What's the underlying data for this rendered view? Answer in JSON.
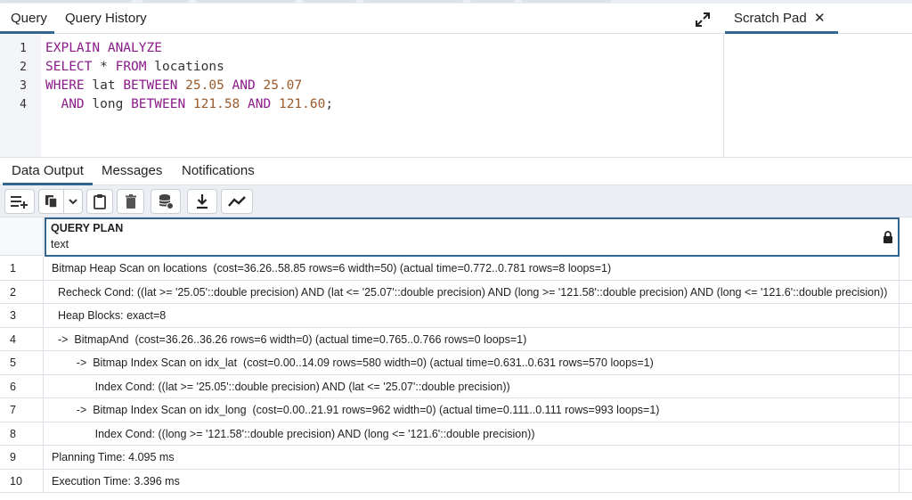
{
  "editor": {
    "tabs": [
      {
        "label": "Query"
      },
      {
        "label": "Query History"
      }
    ],
    "lines": [
      {
        "num": "1"
      },
      {
        "num": "2"
      },
      {
        "num": "3"
      },
      {
        "num": "4"
      }
    ],
    "tokens": {
      "l1_a": "EXPLAIN ANALYZE",
      "l2_a": "SELECT",
      "l2_b": " * ",
      "l2_c": "FROM",
      "l2_d": " locations",
      "l3_a": "WHERE",
      "l3_b": " lat ",
      "l3_c": "BETWEEN",
      "l3_d": " ",
      "l3_e": "25.05",
      "l3_f": " ",
      "l3_g": "AND",
      "l3_h": " ",
      "l3_i": "25.07",
      "l4_a": "  ",
      "l4_b": "AND",
      "l4_c": " long ",
      "l4_d": "BETWEEN",
      "l4_e": " ",
      "l4_f": "121.58",
      "l4_g": " ",
      "l4_h": "AND",
      "l4_i": " ",
      "l4_j": "121.60",
      "l4_k": ";"
    },
    "expand_icon": "expand-icon"
  },
  "scratch": {
    "tab_label": "Scratch Pad",
    "close_label": "✕"
  },
  "results": {
    "tabs": [
      {
        "label": "Data Output"
      },
      {
        "label": "Messages"
      },
      {
        "label": "Notifications"
      }
    ],
    "toolbar_icons": [
      "add-row-icon",
      "copy-icon",
      "chevron-down-icon",
      "paste-icon",
      "delete-icon",
      "save-data-icon",
      "download-icon",
      "graph-icon"
    ],
    "column": {
      "name": "QUERY PLAN",
      "type": "text"
    },
    "rows": [
      {
        "num": "1",
        "text": "Bitmap Heap Scan on locations  (cost=36.26..58.85 rows=6 width=50) (actual time=0.772..0.781 rows=8 loops=1)"
      },
      {
        "num": "2",
        "text": "  Recheck Cond: ((lat >= '25.05'::double precision) AND (lat <= '25.07'::double precision) AND (long >= '121.58'::double precision) AND (long <= '121.6'::double precision))"
      },
      {
        "num": "3",
        "text": "  Heap Blocks: exact=8"
      },
      {
        "num": "4",
        "text": "  ->  BitmapAnd  (cost=36.26..36.26 rows=6 width=0) (actual time=0.765..0.766 rows=0 loops=1)"
      },
      {
        "num": "5",
        "text": "        ->  Bitmap Index Scan on idx_lat  (cost=0.00..14.09 rows=580 width=0) (actual time=0.631..0.631 rows=570 loops=1)"
      },
      {
        "num": "6",
        "text": "              Index Cond: ((lat >= '25.05'::double precision) AND (lat <= '25.07'::double precision))"
      },
      {
        "num": "7",
        "text": "        ->  Bitmap Index Scan on idx_long  (cost=0.00..21.91 rows=962 width=0) (actual time=0.111..0.111 rows=993 loops=1)"
      },
      {
        "num": "8",
        "text": "              Index Cond: ((long >= '121.58'::double precision) AND (long <= '121.6'::double precision))"
      },
      {
        "num": "9",
        "text": "Planning Time: 4.095 ms"
      },
      {
        "num": "10",
        "text": "Execution Time: 3.396 ms"
      }
    ],
    "colors": {
      "accent": "#326690",
      "keyword": "#8b1a8b",
      "number": "#9a5a2a",
      "toolbar_bg": "#ebeef3"
    }
  }
}
